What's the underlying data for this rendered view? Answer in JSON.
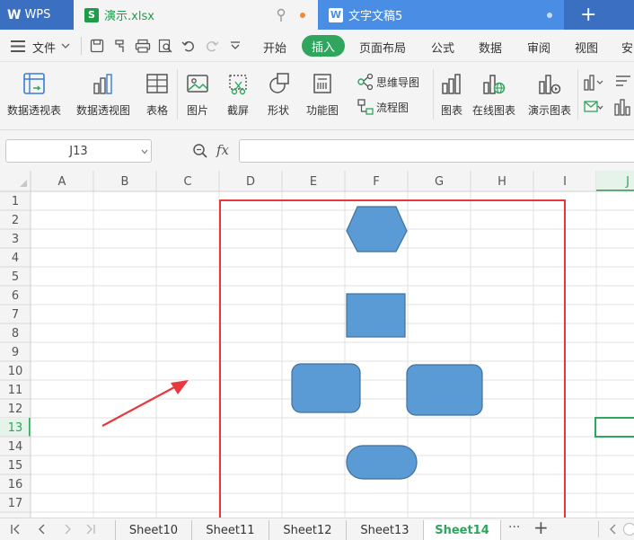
{
  "titlebar": {
    "tabs": [
      {
        "label": "WPS"
      },
      {
        "label": "演示.xlsx"
      },
      {
        "label": "文字文稿5"
      }
    ],
    "new_tab_symbol": "+"
  },
  "menu": {
    "file": "文件",
    "items": [
      "开始",
      "插入",
      "页面布局",
      "公式",
      "数据",
      "审阅",
      "视图",
      "安"
    ]
  },
  "ribbon": {
    "buttons": [
      "数据透视表",
      "数据透视图",
      "表格",
      "图片",
      "截屏",
      "形状",
      "功能图",
      "思维导图",
      "流程图",
      "图表",
      "在线图表",
      "演示图表"
    ]
  },
  "formula_bar": {
    "name_box": "J13",
    "fx": "fx",
    "formula": ""
  },
  "grid": {
    "columns": [
      "A",
      "B",
      "C",
      "D",
      "E",
      "F",
      "G",
      "H",
      "I",
      "J"
    ],
    "rows": [
      "1",
      "2",
      "3",
      "4",
      "5",
      "6",
      "7",
      "8",
      "9",
      "10",
      "11",
      "12",
      "13",
      "14",
      "15",
      "16",
      "17"
    ],
    "selected_cell": "J13"
  },
  "shapes": {
    "fill": "#5b9bd5",
    "stroke": "#41719c",
    "highlight_box": "#e8383d",
    "arrow": "#e8383d"
  },
  "sheets": {
    "tabs": [
      "Sheet10",
      "Sheet11",
      "Sheet12",
      "Sheet13",
      "Sheet14"
    ],
    "active": "Sheet14",
    "more": "···",
    "add": "+"
  },
  "colors": {
    "accent_green": "#2fa55d",
    "title_blue": "#4a8de4"
  }
}
